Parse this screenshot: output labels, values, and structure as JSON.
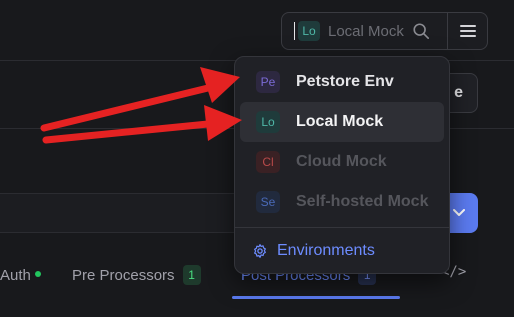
{
  "header": {
    "env_selector": {
      "badge": "Lo",
      "placeholder": "Local Mock",
      "search_icon": "search-icon"
    },
    "menu_icon": "hamburger-menu-icon"
  },
  "save_button": {
    "label_fragment": "e"
  },
  "dropdown": {
    "items": [
      {
        "badge": "Pe",
        "label": "Petstore Env",
        "badge_color": "#7c6bd6",
        "badge_bg": "#2d2840",
        "text_color": "#e4e4e7",
        "active": false
      },
      {
        "badge": "Lo",
        "label": "Local Mock",
        "badge_color": "#4fb8a8",
        "badge_bg": "#1f3b3b",
        "text_color": "#f4f4f5",
        "active": true
      },
      {
        "badge": "Cl",
        "label": "Cloud Mock",
        "badge_color": "#b84a4a",
        "badge_bg": "#3a2124",
        "text_color": "#55565c",
        "active": false
      },
      {
        "badge": "Se",
        "label": "Self-hosted Mock",
        "badge_color": "#4a6ab8",
        "badge_bg": "#212a3d",
        "text_color": "#55565c",
        "active": false
      }
    ],
    "footer": {
      "label": "Environments",
      "icon": "gear-icon"
    }
  },
  "tabs": {
    "auth": {
      "label": "Auth"
    },
    "pre_processors": {
      "label": "Pre Processors",
      "count": "1"
    },
    "post_processors": {
      "label": "Post Processors",
      "count": "1"
    },
    "more": "···",
    "code": "</>"
  },
  "colors": {
    "accent": "#5b7bf0",
    "annotation_arrow": "#e52222"
  }
}
